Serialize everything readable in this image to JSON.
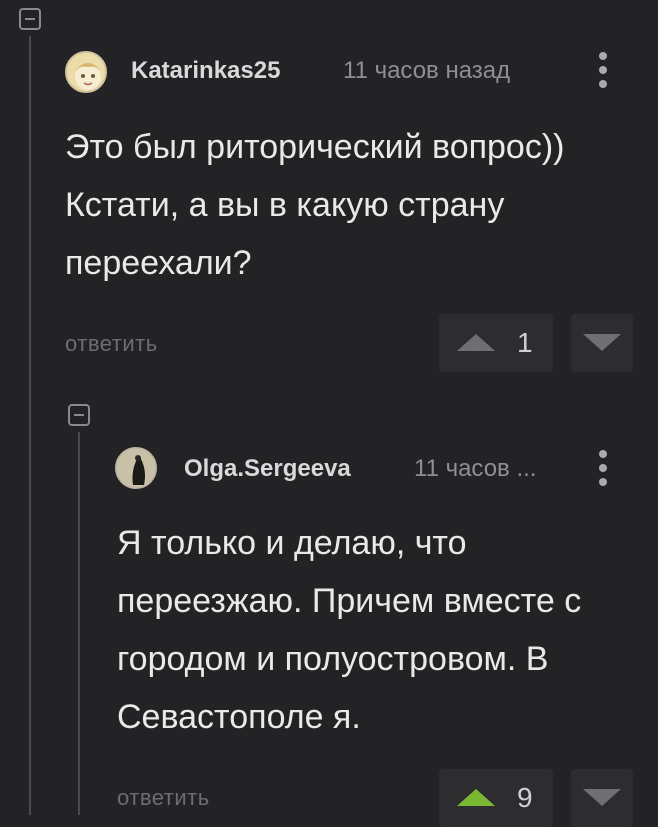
{
  "colors": {
    "background": "#232325",
    "vote_active": "#7bb832",
    "vote_inactive": "#6f6f73"
  },
  "comments": [
    {
      "username": "Katarinkas25",
      "timestamp": "11 часов назад",
      "text": "Это был риторический вопрос)) Кстати, а вы в какую страну переехали?",
      "reply_label": "ответить",
      "rating": "1",
      "upvoted": false,
      "avatar_icon": "cartoon-face-avatar"
    },
    {
      "username": "Olga.Sergeeva",
      "timestamp": "11 часов ...",
      "text": "Я только и делаю, что переезжаю. Причем вместе с городом и полуостровом. В Севастополе я.",
      "reply_label": "ответить",
      "rating": "9",
      "upvoted": true,
      "avatar_icon": "dark-figure-avatar"
    }
  ]
}
